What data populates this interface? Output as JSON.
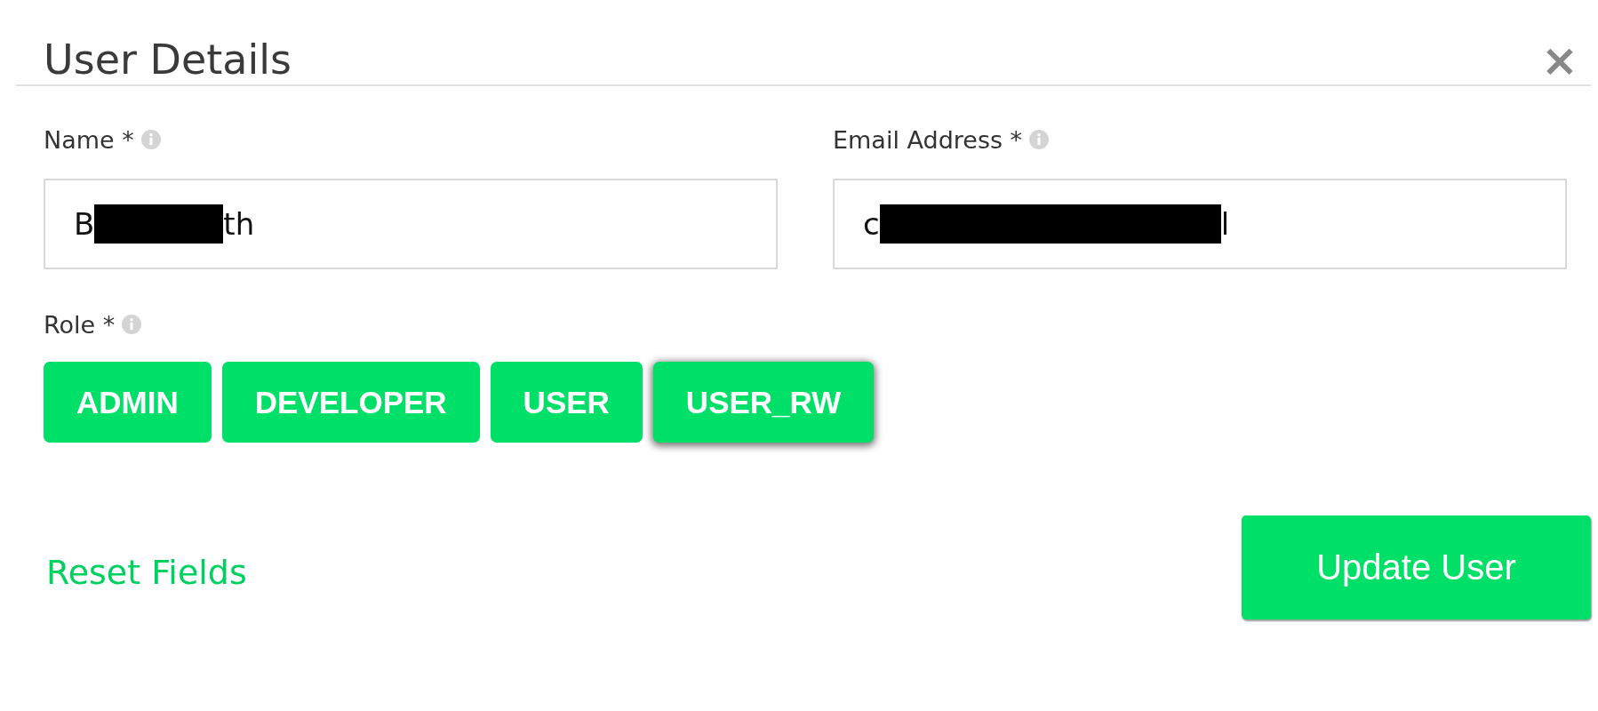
{
  "dialog": {
    "title": "User Details",
    "close": "×"
  },
  "fields": [
    {
      "label": "Name *",
      "value_start": "B",
      "value_end": "th",
      "redacted": true
    },
    {
      "label": "Email Address *",
      "value_start": "c",
      "value_end": "l",
      "redacted": true
    }
  ],
  "role": {
    "label": "Role *",
    "options": [
      {
        "label": "ADMIN",
        "selected": false
      },
      {
        "label": "DEVELOPER",
        "selected": false
      },
      {
        "label": "USER",
        "selected": false
      },
      {
        "label": "USER_RW",
        "selected": true
      }
    ]
  },
  "footer": {
    "link": "Reset Fields",
    "button": "Update User"
  }
}
